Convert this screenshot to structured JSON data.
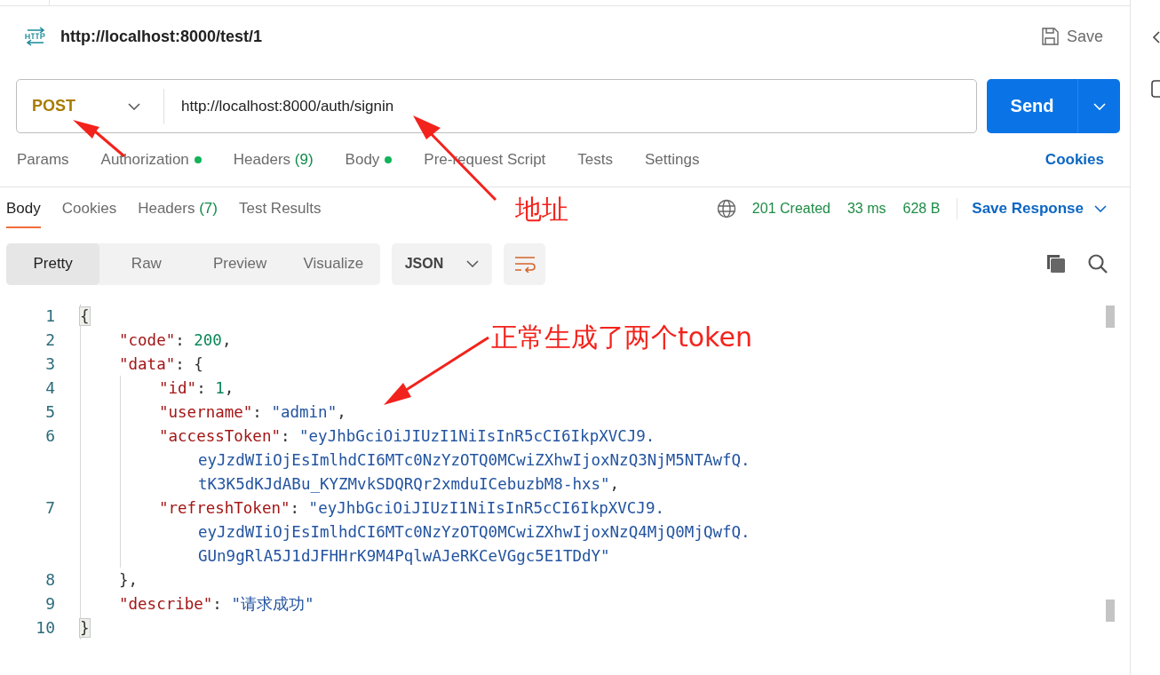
{
  "request": {
    "title": "http://localhost:8000/test/1",
    "save_label": "Save",
    "method": "POST",
    "url": "http://localhost:8000/auth/signin",
    "send_label": "Send"
  },
  "request_tabs": [
    {
      "label": "Params",
      "dot": false,
      "selected": false
    },
    {
      "label": "Authorization",
      "dot": true,
      "selected": false
    },
    {
      "label": "Headers",
      "count": "(9)",
      "dot": false,
      "selected": false
    },
    {
      "label": "Body",
      "dot": true,
      "selected": false
    },
    {
      "label": "Pre-request Script",
      "dot": false,
      "selected": false
    },
    {
      "label": "Tests",
      "dot": false,
      "selected": false
    },
    {
      "label": "Settings",
      "dot": false,
      "selected": false
    }
  ],
  "cookies_link": "Cookies",
  "response_tabs": [
    {
      "label": "Body",
      "selected": true
    },
    {
      "label": "Cookies",
      "selected": false
    },
    {
      "label": "Headers",
      "count": "(7)",
      "selected": false
    },
    {
      "label": "Test Results",
      "selected": false
    }
  ],
  "status": {
    "code": "201 Created",
    "time": "33 ms",
    "size": "628 B",
    "save_response": "Save Response"
  },
  "view_modes": [
    {
      "label": "Pretty",
      "selected": true
    },
    {
      "label": "Raw",
      "selected": false
    },
    {
      "label": "Preview",
      "selected": false
    },
    {
      "label": "Visualize",
      "selected": false
    }
  ],
  "format": "JSON",
  "code_lines": [
    {
      "number": "1",
      "tokens": [
        {
          "kind": "punct",
          "text": "{",
          "highlighted": true
        }
      ],
      "children": [
        {
          "number": "2",
          "tokens": [
            {
              "kind": "key",
              "text": "\"code\""
            },
            {
              "kind": "punct",
              "text": ": "
            },
            {
              "kind": "number",
              "text": "200"
            },
            {
              "kind": "punct",
              "text": ","
            }
          ]
        },
        {
          "number": "3",
          "tokens": [
            {
              "kind": "key",
              "text": "\"data\""
            },
            {
              "kind": "punct",
              "text": ": {"
            }
          ],
          "children": [
            {
              "number": "4",
              "tokens": [
                {
                  "kind": "key",
                  "text": "\"id\""
                },
                {
                  "kind": "punct",
                  "text": ": "
                },
                {
                  "kind": "number",
                  "text": "1"
                },
                {
                  "kind": "punct",
                  "text": ","
                }
              ]
            },
            {
              "number": "5",
              "tokens": [
                {
                  "kind": "key",
                  "text": "\"username\""
                },
                {
                  "kind": "punct",
                  "text": ": "
                },
                {
                  "kind": "string",
                  "text": "\"admin\""
                },
                {
                  "kind": "punct",
                  "text": ","
                }
              ]
            },
            {
              "number": "6",
              "tokens": [
                {
                  "kind": "key",
                  "text": "\"accessToken\""
                },
                {
                  "kind": "punct",
                  "text": ": "
                },
                {
                  "kind": "string",
                  "text": "\"eyJhbGciOiJIUzI1NiIsInR5cCI6IkpXVCJ9."
                }
              ],
              "wraps": [
                [
                  {
                    "kind": "string",
                    "text": "eyJzdWIiOjEsImlhdCI6MTc0NzYzOTQ0MCwiZXhwIjoxNzQ3NjM5NTAwfQ."
                  }
                ],
                [
                  {
                    "kind": "string",
                    "text": "tK3K5dKJdABu_KYZMvkSDQRQr2xmduICebuzbM8-hxs\""
                  },
                  {
                    "kind": "punct",
                    "text": ","
                  }
                ]
              ]
            },
            {
              "number": "7",
              "tokens": [
                {
                  "kind": "key",
                  "text": "\"refreshToken\""
                },
                {
                  "kind": "punct",
                  "text": ": "
                },
                {
                  "kind": "string",
                  "text": "\"eyJhbGciOiJIUzI1NiIsInR5cCI6IkpXVCJ9."
                }
              ],
              "wraps": [
                [
                  {
                    "kind": "string",
                    "text": "eyJzdWIiOjEsImlhdCI6MTc0NzYzOTQ0MCwiZXhwIjoxNzQ4MjQ0MjQwfQ."
                  }
                ],
                [
                  {
                    "kind": "string",
                    "text": "GUn9gRlA5J1dJFHHrK9M4PqlwAJeRKCeVGgc5E1TDdY\""
                  }
                ]
              ]
            }
          ]
        },
        {
          "number": "8",
          "tokens": [
            {
              "kind": "punct",
              "text": "},"
            }
          ]
        },
        {
          "number": "9",
          "tokens": [
            {
              "kind": "key",
              "text": "\"describe\""
            },
            {
              "kind": "punct",
              "text": ": "
            },
            {
              "kind": "string",
              "text": "\"请求成功\""
            }
          ]
        }
      ]
    },
    {
      "number": "10",
      "tokens": [
        {
          "kind": "punct",
          "text": "}",
          "highlighted": true
        }
      ]
    }
  ],
  "annotations": [
    {
      "text": "地址"
    },
    {
      "text": "正常生成了两个token"
    }
  ]
}
